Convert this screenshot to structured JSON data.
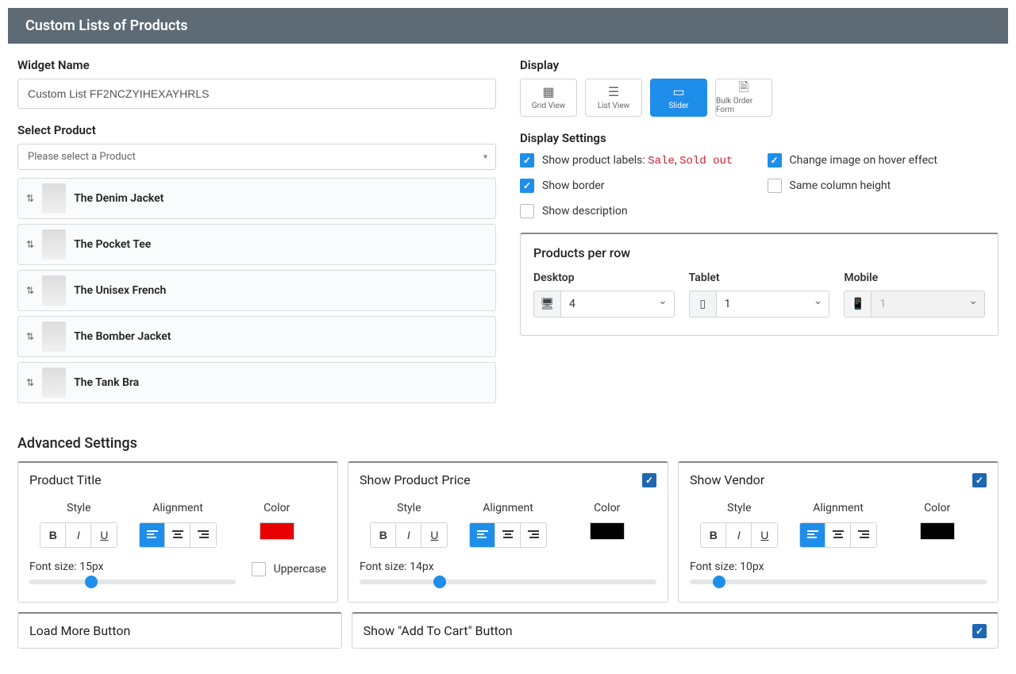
{
  "header": {
    "title": "Custom Lists of Products"
  },
  "left": {
    "widget_name_label": "Widget Name",
    "widget_name_value": "Custom List FF2NCZYIHEXAYHRLS",
    "select_product_label": "Select Product",
    "select_placeholder": "Please select a Product",
    "products": [
      {
        "name": "The Denim Jacket"
      },
      {
        "name": "The Pocket Tee"
      },
      {
        "name": "The Unisex French"
      },
      {
        "name": "The Bomber Jacket"
      },
      {
        "name": "The Tank Bra"
      }
    ]
  },
  "right": {
    "display_label": "Display",
    "display_options": [
      {
        "label": "Grid View",
        "glyph": "▦"
      },
      {
        "label": "List View",
        "glyph": "☰"
      },
      {
        "label": "Slider",
        "glyph": "▭"
      },
      {
        "label": "Bulk Order Form",
        "glyph": "🗎"
      }
    ],
    "display_active_index": 2,
    "display_settings_label": "Display Settings",
    "checks": {
      "show_labels_prefix": "Show product labels: ",
      "label_sale": "Sale",
      "label_sep": ", ",
      "label_sold": "Sold out",
      "change_hover": "Change image on hover effect",
      "show_border": "Show border",
      "same_height": "Same column height",
      "show_desc": "Show description"
    },
    "checks_state": {
      "show_labels": true,
      "change_hover": true,
      "show_border": true,
      "same_height": false,
      "show_desc": false
    },
    "ppr": {
      "title": "Products per row",
      "desktop_label": "Desktop",
      "tablet_label": "Tablet",
      "mobile_label": "Mobile",
      "desktop_value": "4",
      "tablet_value": "1",
      "mobile_value": "1"
    }
  },
  "advanced": {
    "title": "Advanced Settings",
    "style_label": "Style",
    "alignment_label": "Alignment",
    "color_label": "Color",
    "font_prefix": "Font size: ",
    "uppercase_label": "Uppercase",
    "cards": {
      "title": {
        "title": "Product Title",
        "has_toggle": false,
        "color": "#e60000",
        "font_size": "15px",
        "align_on": 0,
        "slider_pct": 30
      },
      "price": {
        "title": "Show Product Price",
        "has_toggle": true,
        "color": "#000000",
        "font_size": "14px",
        "align_on": 0,
        "slider_pct": 27
      },
      "vendor": {
        "title": "Show Vendor",
        "has_toggle": true,
        "color": "#000000",
        "font_size": "10px",
        "align_on": 0,
        "slider_pct": 10
      },
      "loadmore": {
        "title": "Load More Button"
      },
      "addcart": {
        "title": "Show \"Add To Cart\" Button"
      }
    }
  }
}
